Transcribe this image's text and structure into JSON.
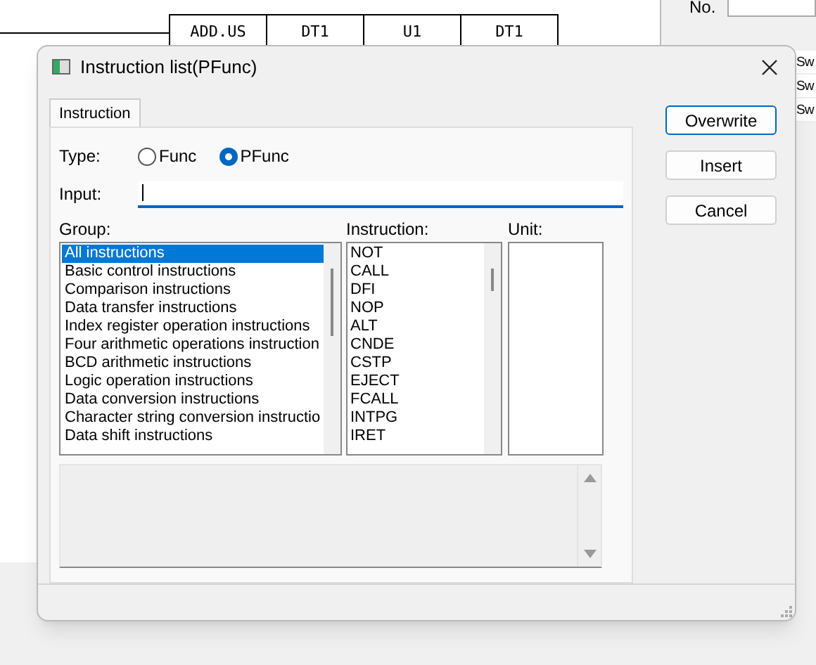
{
  "ladder": {
    "cells": [
      "ADD.US",
      "DT1",
      "U1",
      "DT1"
    ]
  },
  "side_panel": {
    "label": "No.",
    "rows": [
      "Sw",
      "Sw",
      "Sw"
    ]
  },
  "dialog": {
    "title": "Instruction list(PFunc)",
    "tabs": [
      {
        "label": "Instruction",
        "selected": true
      }
    ],
    "type": {
      "label": "Type:",
      "options": [
        {
          "label": "Func",
          "selected": false
        },
        {
          "label": "PFunc",
          "selected": true
        }
      ]
    },
    "input": {
      "label": "Input:"
    },
    "group": {
      "label": "Group:",
      "items": [
        {
          "label": "All instructions",
          "selected": true
        },
        {
          "label": "Basic control instructions",
          "selected": false
        },
        {
          "label": "Comparison instructions",
          "selected": false
        },
        {
          "label": "Data transfer instructions",
          "selected": false
        },
        {
          "label": "Index register operation instructions",
          "selected": false
        },
        {
          "label": "Four arithmetic operations instruction",
          "selected": false
        },
        {
          "label": "BCD arithmetic instructions",
          "selected": false
        },
        {
          "label": "Logic operation instructions",
          "selected": false
        },
        {
          "label": "Data conversion instructions",
          "selected": false
        },
        {
          "label": "Character string conversion instructio",
          "selected": false
        },
        {
          "label": "Data shift instructions",
          "selected": false
        }
      ]
    },
    "instruction": {
      "label": "Instruction:",
      "items": [
        "NOT",
        "CALL",
        "DFI",
        "NOP",
        "ALT",
        "CNDE",
        "CSTP",
        "EJECT",
        "FCALL",
        "INTPG",
        "IRET"
      ]
    },
    "unit": {
      "label": "Unit:"
    },
    "buttons": [
      {
        "label": "Overwrite",
        "default": true
      },
      {
        "label": "Insert",
        "default": false
      },
      {
        "label": "Cancel",
        "default": false
      }
    ]
  }
}
